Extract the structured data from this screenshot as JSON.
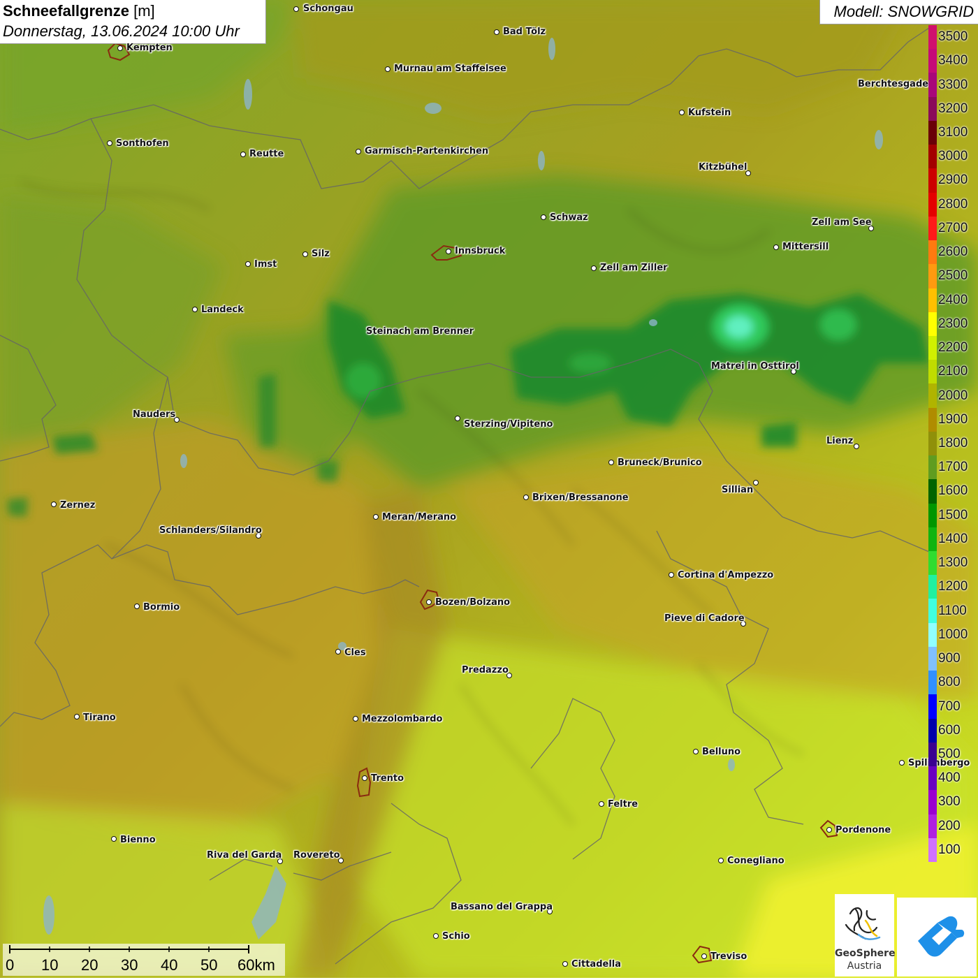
{
  "title": {
    "main": "Schneefallgrenze",
    "unit": "[m]",
    "datetime": "Donnerstag, 13.06.2024 10:00 Uhr"
  },
  "model": {
    "label": "Modell: SNOWGRID"
  },
  "legend": {
    "values": [
      "3500",
      "3400",
      "3300",
      "3200",
      "3100",
      "3000",
      "2900",
      "2800",
      "2700",
      "2600",
      "2500",
      "2400",
      "2300",
      "2200",
      "2100",
      "2000",
      "1900",
      "1800",
      "1700",
      "1600",
      "1500",
      "1400",
      "1300",
      "1200",
      "1100",
      "1000",
      "900",
      "800",
      "700",
      "600",
      "500",
      "400",
      "300",
      "200",
      "100"
    ],
    "colors": [
      "#d0106e",
      "#c50a78",
      "#a8067a",
      "#8a0a5a",
      "#6a0008",
      "#a30000",
      "#cc0000",
      "#e40000",
      "#ff1a1a",
      "#ff7a10",
      "#ff9a10",
      "#ffc000",
      "#ffff00",
      "#d0f000",
      "#c0dc00",
      "#b0b400",
      "#b08c00",
      "#90900a",
      "#609c20",
      "#006400",
      "#009600",
      "#10b410",
      "#30dc30",
      "#20f0a0",
      "#40ffe0",
      "#90ffff",
      "#80c0ff",
      "#3090ff",
      "#0000ff",
      "#0000aa",
      "#3a0090",
      "#6a00c0",
      "#9a00d0",
      "#b020e0",
      "#d070ff"
    ]
  },
  "scale": {
    "labels": [
      "0",
      "10",
      "20",
      "30",
      "40",
      "50",
      "60km"
    ]
  },
  "cities": [
    {
      "name": "Schongau",
      "dot": [
        424,
        13
      ],
      "lab": [
        434,
        6
      ]
    },
    {
      "name": "Bad Tölz",
      "dot": [
        711,
        46
      ],
      "lab": [
        720,
        39
      ]
    },
    {
      "name": "Kempten",
      "dot": [
        172,
        69
      ],
      "lab": [
        181,
        62
      ]
    },
    {
      "name": "Murnau am Staffelsee",
      "dot": [
        555,
        99
      ],
      "lab": [
        564,
        92
      ]
    },
    {
      "name": "Kufstein",
      "dot": [
        976,
        161
      ],
      "lab": [
        985,
        155
      ]
    },
    {
      "name": "Berchtesgaden",
      "dot": [
        1333,
        121
      ],
      "lab": [
        1228,
        114
      ]
    },
    {
      "name": "Sonthofen",
      "dot": [
        157,
        205
      ],
      "lab": [
        166,
        199
      ]
    },
    {
      "name": "Reutte",
      "dot": [
        348,
        221
      ],
      "lab": [
        357,
        214
      ]
    },
    {
      "name": "Garmisch-Partenkirchen",
      "dot": [
        513,
        217
      ],
      "lab": [
        522,
        210
      ]
    },
    {
      "name": "Kitzbühel",
      "dot": [
        1071,
        248
      ],
      "lab": [
        1000,
        233
      ]
    },
    {
      "name": "Schwaz",
      "dot": [
        778,
        311
      ],
      "lab": [
        787,
        305
      ]
    },
    {
      "name": "Zell am See",
      "dot": [
        1247,
        327
      ],
      "lab": [
        1162,
        312
      ]
    },
    {
      "name": "Mittersill",
      "dot": [
        1111,
        354
      ],
      "lab": [
        1120,
        347
      ]
    },
    {
      "name": "Innsbruck",
      "dot": [
        642,
        360
      ],
      "lab": [
        651,
        353
      ]
    },
    {
      "name": "Silz",
      "dot": [
        437,
        364
      ],
      "lab": [
        446,
        357
      ]
    },
    {
      "name": "Imst",
      "dot": [
        355,
        378
      ],
      "lab": [
        364,
        372
      ]
    },
    {
      "name": "Zell am Ziller",
      "dot": [
        850,
        384
      ],
      "lab": [
        859,
        377
      ]
    },
    {
      "name": "Landeck",
      "dot": [
        279,
        443
      ],
      "lab": [
        288,
        437
      ]
    },
    {
      "name": "Steinach am Brenner",
      "dot": [
        671,
        474
      ],
      "lab": [
        524,
        468
      ]
    },
    {
      "name": "Matrei in Osttirol",
      "dot": [
        1136,
        532
      ],
      "lab": [
        1018,
        518
      ]
    },
    {
      "name": "Nauders",
      "dot": [
        253,
        601
      ],
      "lab": [
        190,
        587
      ]
    },
    {
      "name": "Sterzing/Vipiteno",
      "dot": [
        655,
        599
      ],
      "lab": [
        664,
        601
      ]
    },
    {
      "name": "Lienz",
      "dot": [
        1226,
        639
      ],
      "lab": [
        1183,
        625
      ]
    },
    {
      "name": "Bruneck/Brunico",
      "dot": [
        875,
        662
      ],
      "lab": [
        884,
        656
      ]
    },
    {
      "name": "Sillian",
      "dot": [
        1082,
        691
      ],
      "lab": [
        1033,
        695
      ]
    },
    {
      "name": "Brixen/Bressanone",
      "dot": [
        753,
        712
      ],
      "lab": [
        762,
        706
      ]
    },
    {
      "name": "Zernez",
      "dot": [
        77,
        722
      ],
      "lab": [
        86,
        717
      ]
    },
    {
      "name": "Meran/Merano",
      "dot": [
        538,
        740
      ],
      "lab": [
        547,
        734
      ]
    },
    {
      "name": "Schlanders/Silandro",
      "dot": [
        370,
        767
      ],
      "lab": [
        228,
        753
      ]
    },
    {
      "name": "Cortina d'Ampezzo",
      "dot": [
        961,
        823
      ],
      "lab": [
        970,
        817
      ]
    },
    {
      "name": "Bozen/Bolzano",
      "dot": [
        614,
        862
      ],
      "lab": [
        623,
        856
      ]
    },
    {
      "name": "Bormio",
      "dot": [
        196,
        868
      ],
      "lab": [
        205,
        863
      ]
    },
    {
      "name": "Pieve di Cadore",
      "dot": [
        1064,
        893
      ],
      "lab": [
        951,
        879
      ]
    },
    {
      "name": "Cles",
      "dot": [
        484,
        933
      ],
      "lab": [
        493,
        928
      ]
    },
    {
      "name": "Predazzo",
      "dot": [
        729,
        967
      ],
      "lab": [
        661,
        953
      ]
    },
    {
      "name": "Tirano",
      "dot": [
        110,
        1026
      ],
      "lab": [
        119,
        1021
      ]
    },
    {
      "name": "Mezzolombardo",
      "dot": [
        509,
        1029
      ],
      "lab": [
        518,
        1023
      ]
    },
    {
      "name": "Belluno",
      "dot": [
        996,
        1076
      ],
      "lab": [
        1005,
        1070
      ]
    },
    {
      "name": "Spilimbergo",
      "dot": [
        1291,
        1092
      ],
      "lab": [
        1300,
        1086
      ]
    },
    {
      "name": "Trento",
      "dot": [
        522,
        1114
      ],
      "lab": [
        531,
        1108
      ]
    },
    {
      "name": "Feltre",
      "dot": [
        861,
        1151
      ],
      "lab": [
        870,
        1145
      ]
    },
    {
      "name": "Pordenone",
      "dot": [
        1187,
        1188
      ],
      "lab": [
        1196,
        1182
      ]
    },
    {
      "name": "Bienno",
      "dot": [
        163,
        1201
      ],
      "lab": [
        172,
        1196
      ]
    },
    {
      "name": "Riva del Garda",
      "dot": [
        401,
        1233
      ],
      "lab": [
        296,
        1218
      ]
    },
    {
      "name": "Rovereto",
      "dot": [
        488,
        1232
      ],
      "lab": [
        420,
        1218
      ]
    },
    {
      "name": "Conegliano",
      "dot": [
        1032,
        1232
      ],
      "lab": [
        1041,
        1226
      ]
    },
    {
      "name": "Bassano del Grappa",
      "dot": [
        787,
        1305
      ],
      "lab": [
        645,
        1292
      ]
    },
    {
      "name": "Schio",
      "dot": [
        624,
        1340
      ],
      "lab": [
        633,
        1334
      ]
    },
    {
      "name": "Treviso",
      "dot": [
        1008,
        1369
      ],
      "lab": [
        1017,
        1363
      ]
    },
    {
      "name": "Cittadella",
      "dot": [
        809,
        1380
      ],
      "lab": [
        818,
        1374
      ]
    }
  ],
  "logos": {
    "geosphere_line1": "GeoSphere",
    "geosphere_line2": "Austria"
  }
}
